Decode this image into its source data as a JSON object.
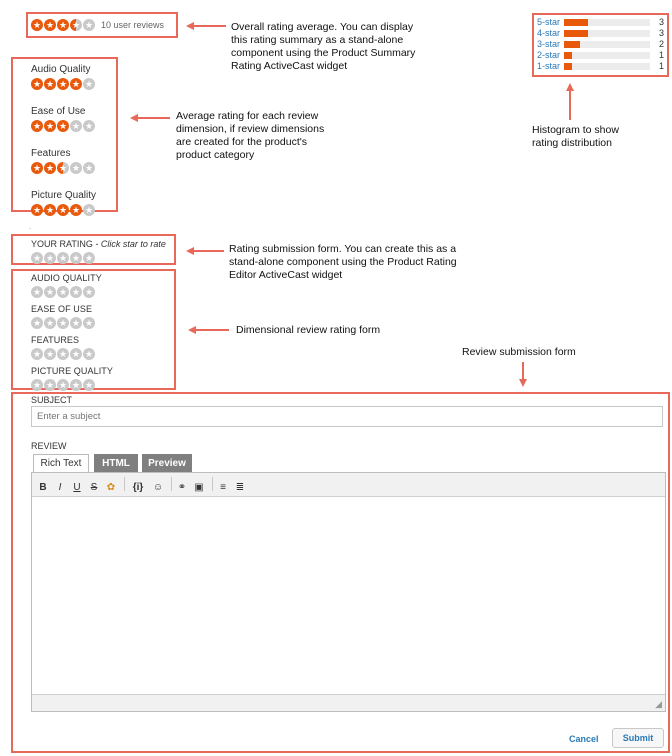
{
  "summary": {
    "stars": [
      "filled",
      "filled",
      "filled",
      "half",
      "empty"
    ],
    "review_count_text": "10 user reviews"
  },
  "callouts": {
    "summary": [
      "Overall rating average. You can display",
      "this rating summary as a stand-alone",
      "component using the Product Summary",
      "Rating ActiveCast widget"
    ],
    "dimensions": [
      "Average rating for each review",
      "dimension, if review dimensions",
      "are created for the product's",
      "product category"
    ],
    "histogram": [
      "Histogram to show",
      "rating distribution"
    ],
    "rating_form": [
      "Rating submission form. You can create this as a",
      "stand-alone component using the Product Rating",
      "Editor ActiveCast widget"
    ],
    "dimensional_form": [
      "Dimensional review rating form"
    ],
    "review_form": [
      "Review submission form"
    ]
  },
  "histogram": {
    "rows": [
      {
        "label": "5-star",
        "count": "3",
        "fraction": 0.28
      },
      {
        "label": "4-star",
        "count": "3",
        "fraction": 0.28
      },
      {
        "label": "3-star",
        "count": "2",
        "fraction": 0.19
      },
      {
        "label": "2-star",
        "count": "1",
        "fraction": 0.09
      },
      {
        "label": "1-star",
        "count": "1",
        "fraction": 0.09
      }
    ]
  },
  "dimensions": [
    {
      "label": "Audio Quality",
      "stars": [
        "filled",
        "filled",
        "filled",
        "filled",
        "empty"
      ]
    },
    {
      "label": "Ease of Use",
      "stars": [
        "filled",
        "filled",
        "filled",
        "empty",
        "empty"
      ]
    },
    {
      "label": "Features",
      "stars": [
        "filled",
        "filled",
        "half",
        "empty",
        "empty"
      ]
    },
    {
      "label": "Picture Quality",
      "stars": [
        "filled",
        "filled",
        "filled",
        "filled",
        "empty"
      ]
    }
  ],
  "your_rating": {
    "label": "YOUR RATING",
    "hint": "- Click star to rate"
  },
  "dimension_form": [
    {
      "label": "AUDIO QUALITY"
    },
    {
      "label": "EASE OF USE"
    },
    {
      "label": "FEATURES"
    },
    {
      "label": "PICTURE QUALITY"
    }
  ],
  "review_form": {
    "subject_label": "SUBJECT",
    "subject_placeholder": "Enter a subject",
    "review_label": "REVIEW",
    "tabs": [
      "Rich Text",
      "HTML",
      "Preview"
    ],
    "toolbar": [
      "bold-icon",
      "italic-icon",
      "underline-icon",
      "strikethrough-icon",
      "style-icon",
      "code-icon",
      "emoji-icon",
      "link-icon",
      "image-icon",
      "ordered-list-icon",
      "bullet-list-icon"
    ],
    "toolbar_glyphs": [
      "B",
      "I",
      "U",
      "S",
      "✿",
      "{i}",
      "☺",
      "⚭",
      "▣",
      "≡",
      "≣"
    ],
    "cancel_label": "Cancel",
    "submit_label": "Submit"
  },
  "colors": {
    "annotation": "#e8685a",
    "star": "#e8590c",
    "link": "#2a7ab8"
  }
}
